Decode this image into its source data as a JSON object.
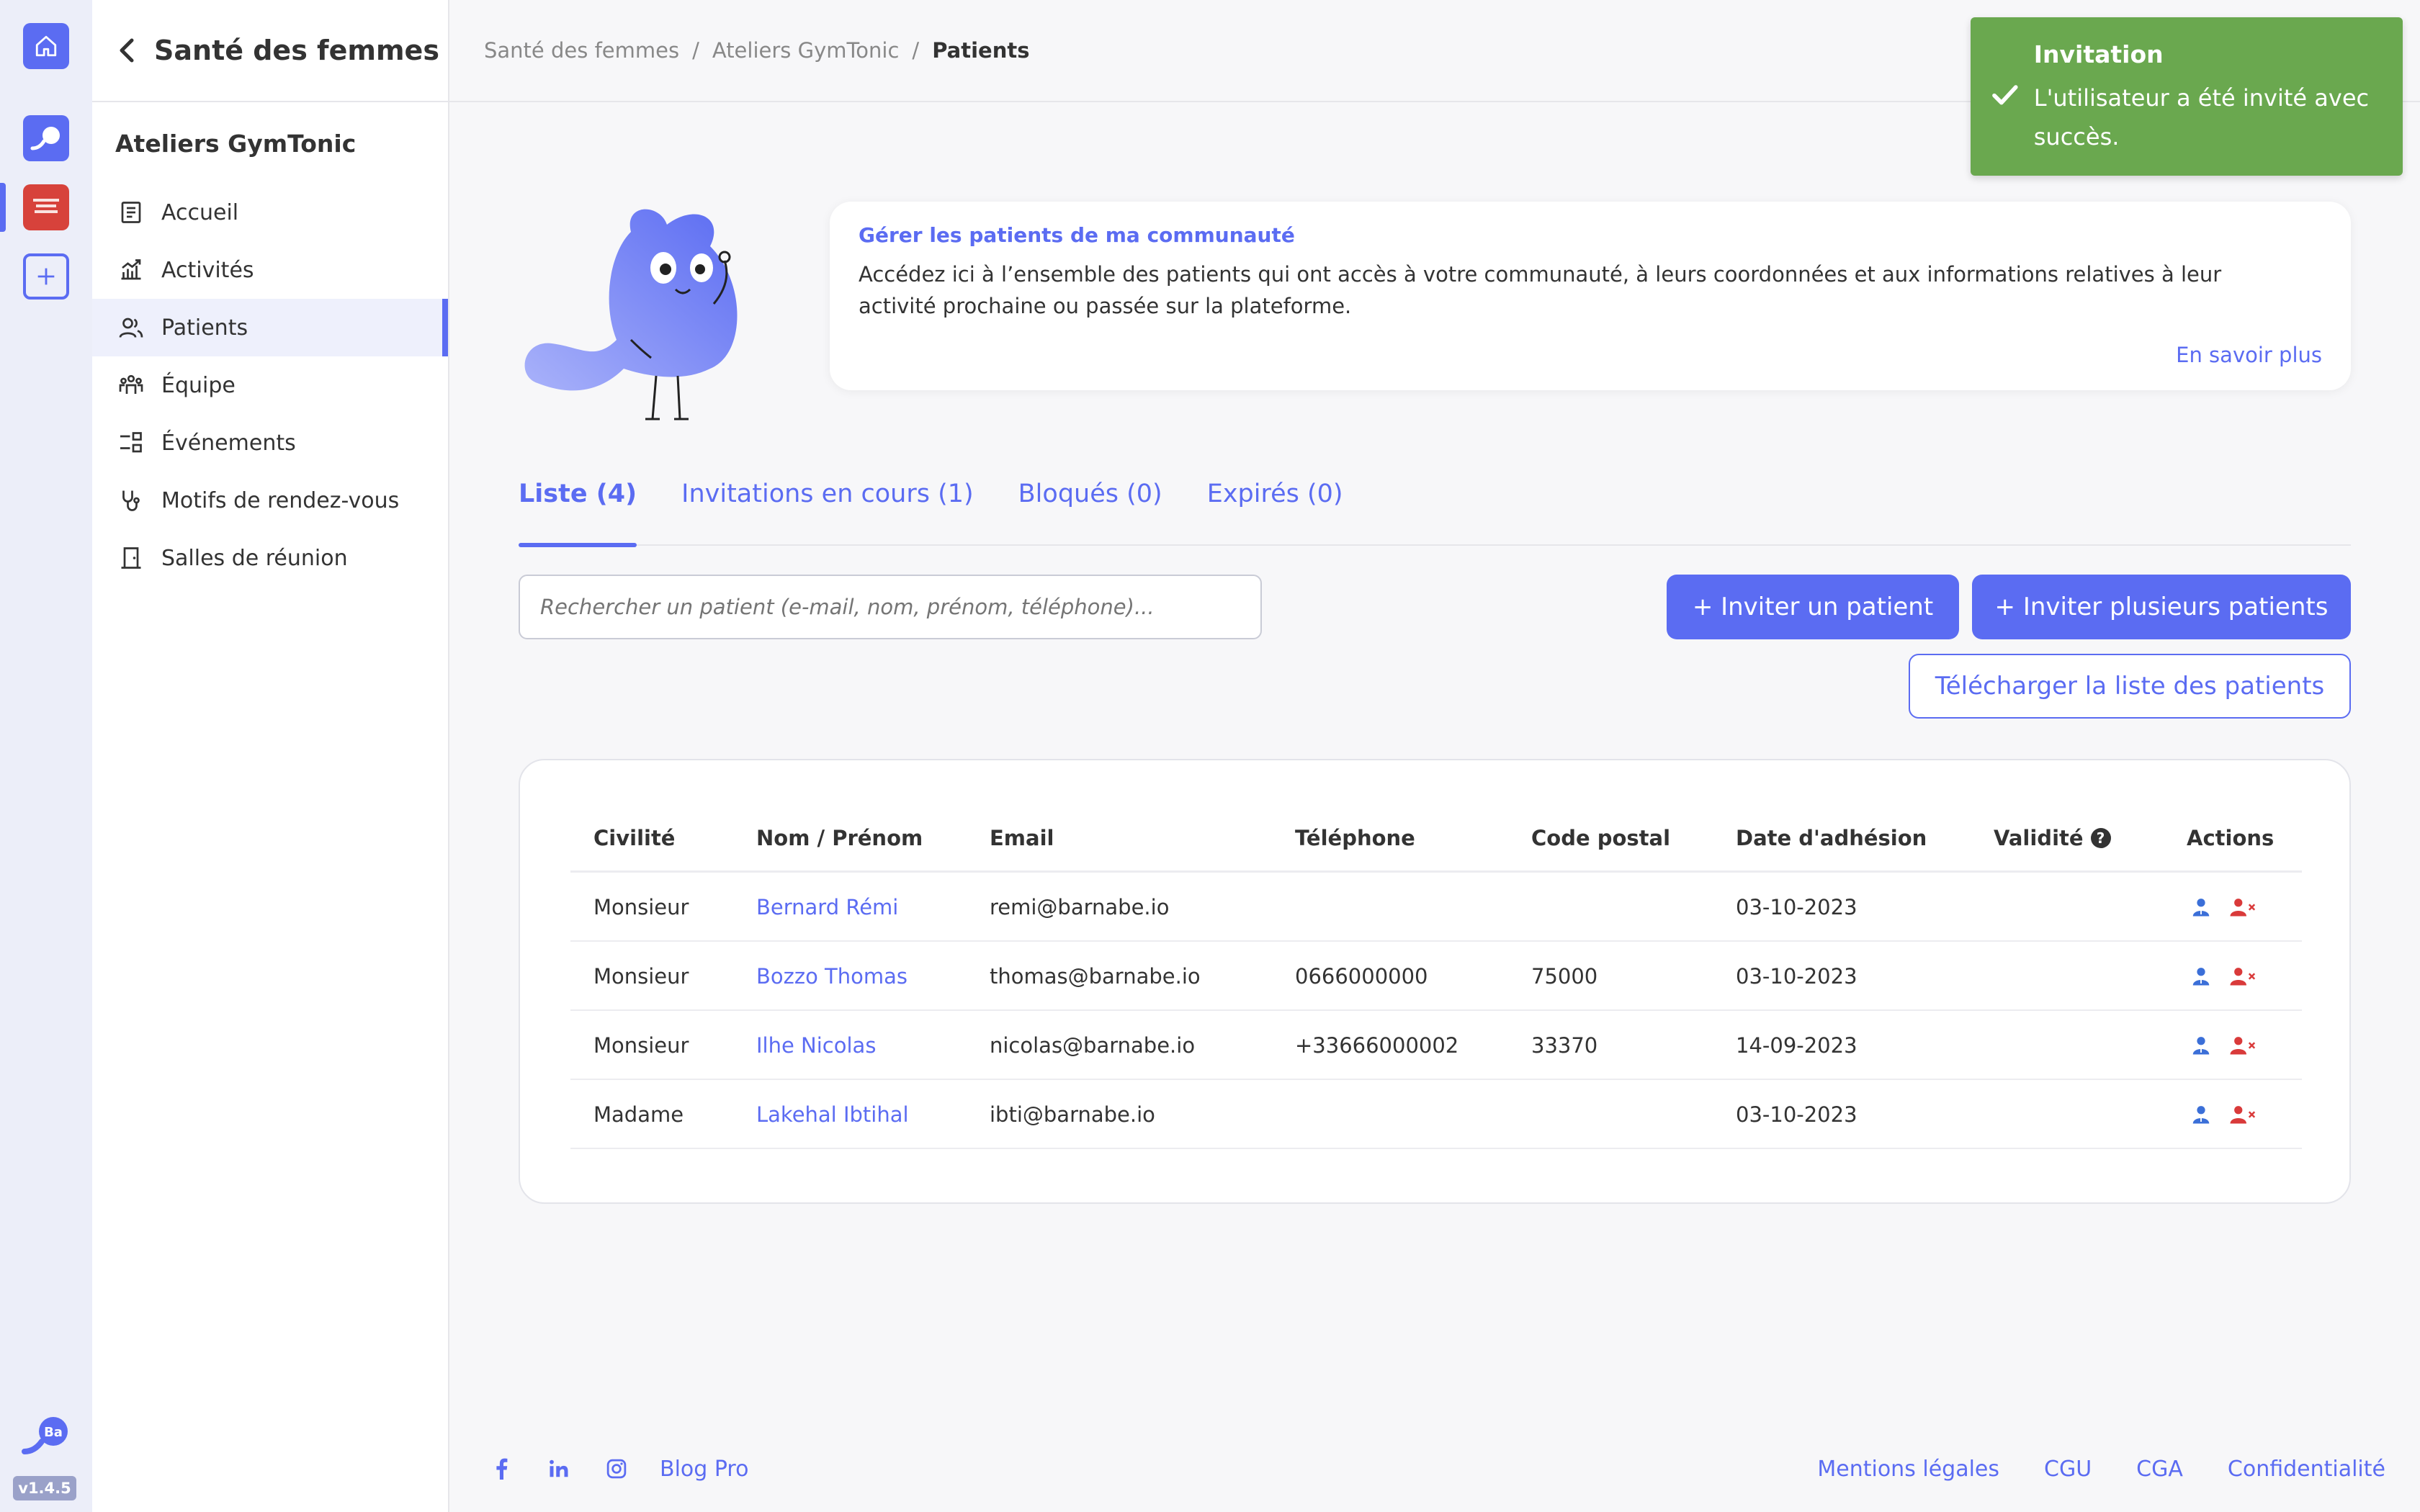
{
  "app": {
    "version": "v1.4.5",
    "rail_logo_text": "Ba"
  },
  "sidebar": {
    "title": "Santé des femmes",
    "section": "Ateliers GymTonic",
    "items": [
      {
        "label": "Accueil",
        "icon": "document-icon"
      },
      {
        "label": "Activités",
        "icon": "chart-icon"
      },
      {
        "label": "Patients",
        "icon": "users-icon",
        "active": true
      },
      {
        "label": "Équipe",
        "icon": "team-icon"
      },
      {
        "label": "Événements",
        "icon": "events-icon"
      },
      {
        "label": "Motifs de rendez-vous",
        "icon": "stethoscope-icon"
      },
      {
        "label": "Salles de réunion",
        "icon": "door-icon"
      }
    ]
  },
  "breadcrumb": {
    "items": [
      "Santé des femmes",
      "Ateliers GymTonic"
    ],
    "current": "Patients"
  },
  "toast": {
    "title": "Invitation",
    "message": "L'utilisateur a été invité avec succès.",
    "color": "#6aa84f"
  },
  "info": {
    "title": "Gérer les patients de ma communauté",
    "text": "Accédez ici à l’ensemble des patients qui ont accès à votre communauté, à leurs coordonnées et aux informations relatives à leur activité prochaine ou passée sur la plateforme.",
    "link": "En savoir plus"
  },
  "tabs": [
    {
      "label": "Liste (4)",
      "active": true
    },
    {
      "label": "Invitations en cours (1)"
    },
    {
      "label": "Bloqués (0)"
    },
    {
      "label": "Expirés (0)"
    }
  ],
  "search": {
    "placeholder": "Rechercher un patient (e-mail, nom, prénom, téléphone)..."
  },
  "buttons": {
    "invite": "+ Inviter un patient",
    "invite_many": "+ Inviter plusieurs patients",
    "download": "Télécharger la liste des patients"
  },
  "table": {
    "headers": {
      "civilite": "Civilité",
      "nom": "Nom / Prénom",
      "email": "Email",
      "telephone": "Téléphone",
      "code_postal": "Code postal",
      "date": "Date d'adhésion",
      "validite": "Validité",
      "actions": "Actions",
      "help": "?"
    },
    "rows": [
      {
        "civilite": "Monsieur",
        "nom": "Bernard Rémi",
        "email": "remi@barnabe.io",
        "telephone": "",
        "code_postal": "",
        "date": "03-10-2023",
        "validite": ""
      },
      {
        "civilite": "Monsieur",
        "nom": "Bozzo Thomas",
        "email": "thomas@barnabe.io",
        "telephone": "0666000000",
        "code_postal": "75000",
        "date": "03-10-2023",
        "validite": ""
      },
      {
        "civilite": "Monsieur",
        "nom": "Ilhe Nicolas",
        "email": "nicolas@barnabe.io",
        "telephone": "+33666000002",
        "code_postal": "33370",
        "date": "14-09-2023",
        "validite": ""
      },
      {
        "civilite": "Madame",
        "nom": "Lakehal Ibtihal",
        "email": "ibti@barnabe.io",
        "telephone": "",
        "code_postal": "",
        "date": "03-10-2023",
        "validite": ""
      }
    ]
  },
  "footer": {
    "blog": "Blog Pro",
    "links": [
      "Mentions légales",
      "CGU",
      "CGA",
      "Confidentialité"
    ]
  },
  "colors": {
    "accent": "#5b6cf2",
    "danger": "#d93a3a",
    "success": "#6aa84f"
  }
}
